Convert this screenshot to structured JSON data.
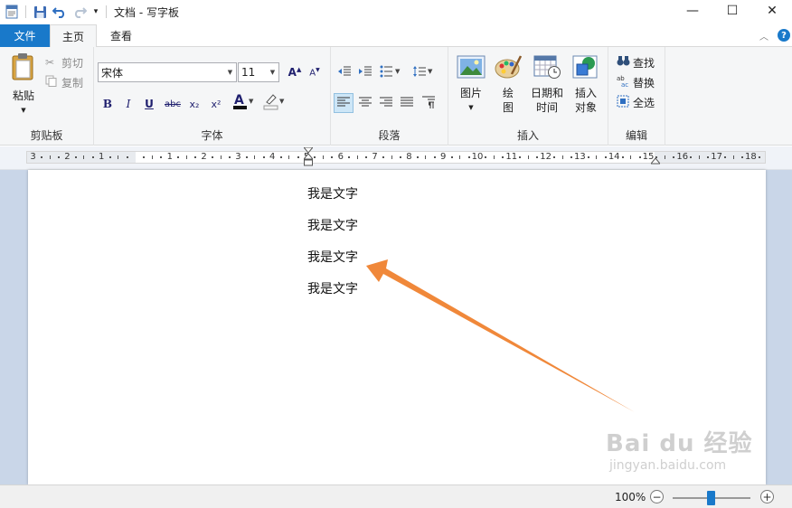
{
  "window": {
    "title": "文档 - 写字板",
    "controls": {
      "minimize": "—",
      "maximize": "☐",
      "close": "✕"
    }
  },
  "tabs": {
    "file": "文件",
    "home": "主页",
    "view": "查看"
  },
  "ribbon": {
    "clipboard": {
      "label": "剪贴板",
      "paste": "粘贴",
      "cut": "剪切",
      "copy": "复制"
    },
    "font": {
      "label": "字体",
      "family": "宋体",
      "size": "11",
      "bold": "B",
      "italic": "I",
      "underline": "U",
      "strike": "abc",
      "subscript": "x₂",
      "superscript": "x²"
    },
    "paragraph": {
      "label": "段落"
    },
    "insert": {
      "label": "插入",
      "picture": "图片",
      "paint_line1": "绘",
      "paint_line2": "图",
      "datetime_line1": "日期和",
      "datetime_line2": "时间",
      "object_line1": "插入",
      "object_line2": "对象"
    },
    "edit": {
      "label": "编辑",
      "find": "查找",
      "replace": "替换",
      "select_all": "全选"
    }
  },
  "ruler": {
    "labels": [
      "3",
      "2",
      "1",
      "1",
      "2",
      "3",
      "4",
      "5",
      "6",
      "7",
      "8",
      "9",
      "10",
      "11",
      "12",
      "13",
      "14",
      "15",
      "16",
      "17",
      "18"
    ]
  },
  "document": {
    "lines": [
      "我是文字",
      "我是文字",
      "我是文字",
      "我是文字"
    ]
  },
  "annotation": {
    "arrow_color": "#f0883a"
  },
  "status": {
    "zoom": "100%",
    "zoom_out": "−",
    "zoom_in": "+",
    "zoom_level": 0.5
  },
  "watermark": {
    "brand": "Bai du 经验",
    "url": "jingyan.baidu.com"
  },
  "colors": {
    "accent": "#1979ca",
    "doc_bg": "#c9d6e8"
  }
}
